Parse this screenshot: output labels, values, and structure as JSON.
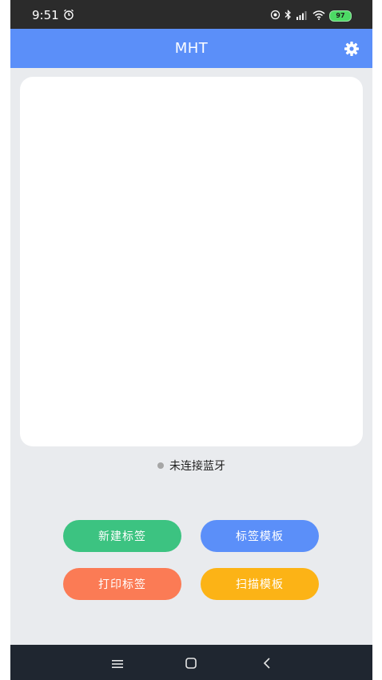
{
  "status_bar": {
    "time": "9:51",
    "battery": "97"
  },
  "app_bar": {
    "title": "MHT",
    "settings_icon": "gear-icon"
  },
  "bluetooth": {
    "status_text": "未连接蓝牙",
    "indicator_color": "#a6a6a6"
  },
  "actions": {
    "new_label": "新建标签",
    "label_template": "标签模板",
    "print_label": "打印标签",
    "scan_template": "扫描模板"
  },
  "colors": {
    "primary": "#5b8ff9",
    "green": "#3cc381",
    "orange": "#fb7b55",
    "yellow": "#fcb316",
    "background": "#e9ebee"
  },
  "nav_bar": {
    "icons": [
      "menu-icon",
      "home-icon",
      "back-icon"
    ]
  }
}
